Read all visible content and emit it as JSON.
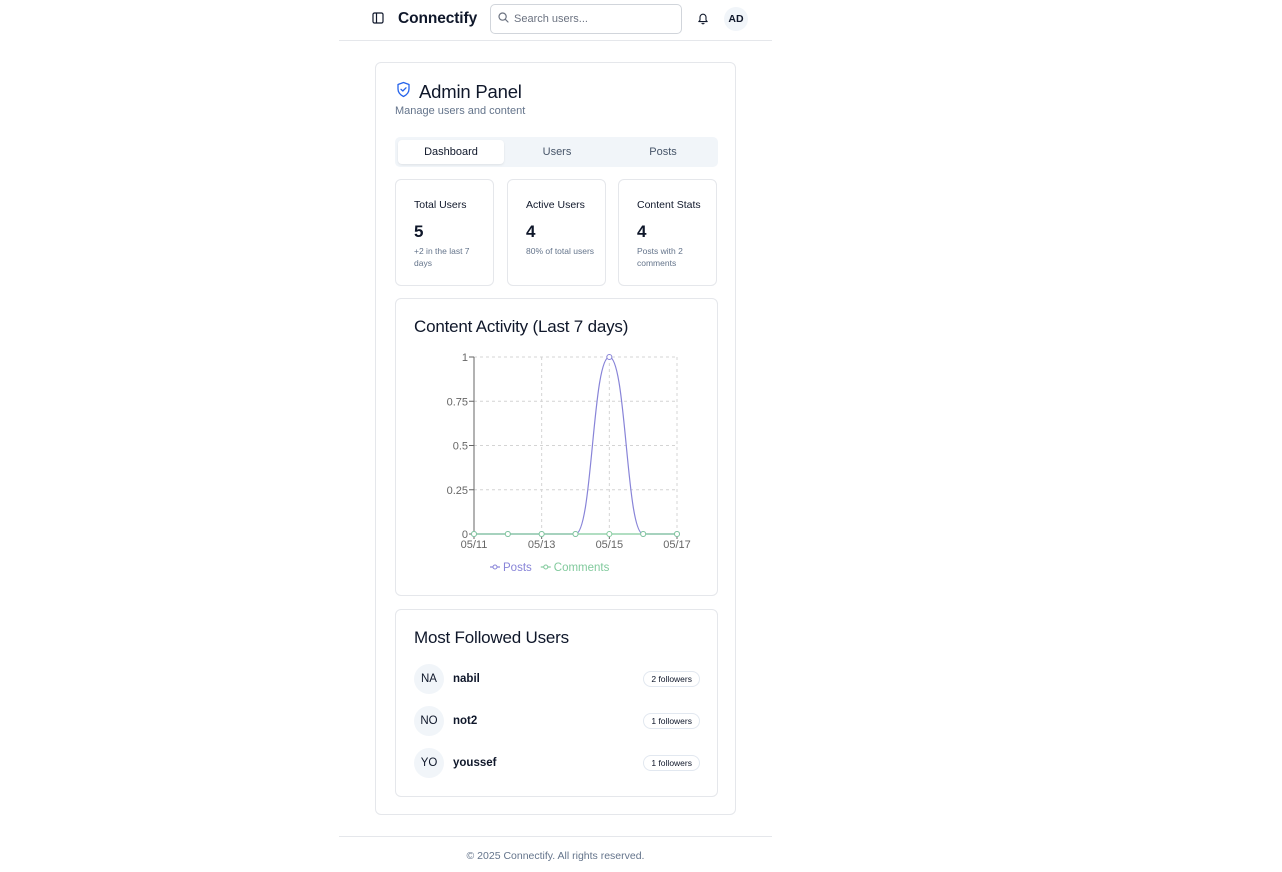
{
  "header": {
    "brand": "Connectify",
    "search_placeholder": "Search users...",
    "avatar_initials": "AD",
    "icons": {
      "sidebar": "sidebar-toggle-icon",
      "search": "search-icon",
      "notifications": "bell-icon"
    }
  },
  "admin": {
    "title": "Admin Panel",
    "subtitle": "Manage users and content",
    "icon": "shield-check-icon",
    "tabs": [
      {
        "label": "Dashboard",
        "active": true
      },
      {
        "label": "Users",
        "active": false
      },
      {
        "label": "Posts",
        "active": false
      }
    ],
    "stats": [
      {
        "title": "Total Users",
        "value": "5",
        "description": "+2 in the last 7 days"
      },
      {
        "title": "Active Users",
        "value": "4",
        "description": "80% of total users"
      },
      {
        "title": "Content Stats",
        "value": "4",
        "description": "Posts with 2 comments"
      }
    ]
  },
  "chart_title": "Content Activity (Last 7 days)",
  "chart_data": {
    "type": "line",
    "x": [
      "05/11",
      "05/12",
      "05/13",
      "05/14",
      "05/15",
      "05/16",
      "05/17"
    ],
    "x_tick_labels": [
      "05/11",
      "05/13",
      "05/15",
      "05/17"
    ],
    "series": [
      {
        "name": "Posts",
        "values": [
          0,
          0,
          0,
          0,
          1,
          0,
          0
        ],
        "color": "#8884d8"
      },
      {
        "name": "Comments",
        "values": [
          0,
          0,
          0,
          0,
          0,
          0,
          0
        ],
        "color": "#82ca9d"
      }
    ],
    "ylim": [
      0,
      1
    ],
    "y_ticks": [
      "0",
      "0.25",
      "0.5",
      "0.75",
      "1"
    ],
    "grid": true,
    "legend_position": "bottom"
  },
  "most_followed": {
    "title": "Most Followed Users",
    "users": [
      {
        "initials": "NA",
        "name": "nabil",
        "followers": "2 followers"
      },
      {
        "initials": "NO",
        "name": "not2",
        "followers": "1 followers"
      },
      {
        "initials": "YO",
        "name": "youssef",
        "followers": "1 followers"
      }
    ]
  },
  "footer": {
    "text": "© 2025 Connectify. All rights reserved."
  }
}
